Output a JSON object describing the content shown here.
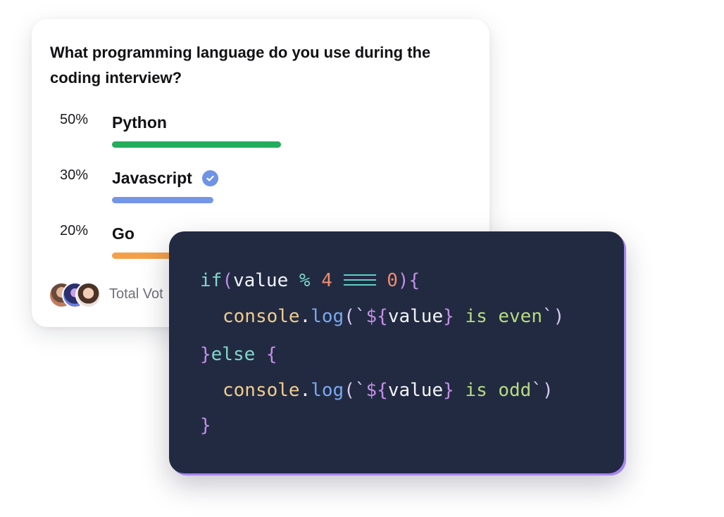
{
  "poll": {
    "question": "What programming language do you use during the coding interview?",
    "options": [
      {
        "percent_label": "50%",
        "label": "Python",
        "share": 0.5,
        "color": "#22ad5c",
        "selected": false
      },
      {
        "percent_label": "30%",
        "label": "Javascript",
        "share": 0.3,
        "color": "#7596e7",
        "selected": true
      },
      {
        "percent_label": "20%",
        "label": "Go",
        "share": 0.2,
        "color": "#f4a04a",
        "selected": false
      }
    ],
    "footer": {
      "total_votes_label": "Total Vot"
    }
  },
  "code": {
    "lines": [
      {
        "tokens": [
          "if",
          "(",
          "value",
          " % ",
          "4",
          " ",
          "==",
          " ",
          "0",
          ")",
          "{"
        ]
      },
      {
        "tokens": [
          "console",
          ".",
          "log",
          "(`",
          "${",
          "value",
          "}",
          " is even",
          "`)"
        ]
      },
      {
        "tokens": [
          "}",
          "else",
          " {"
        ]
      },
      {
        "tokens": [
          "console",
          ".",
          "log",
          "(`",
          "${",
          "value",
          "}",
          " is odd",
          "`)"
        ]
      },
      {
        "tokens": [
          "}"
        ]
      }
    ]
  },
  "colors": {
    "code_background": "#222a42",
    "code_border_accent": "#a886ee"
  }
}
